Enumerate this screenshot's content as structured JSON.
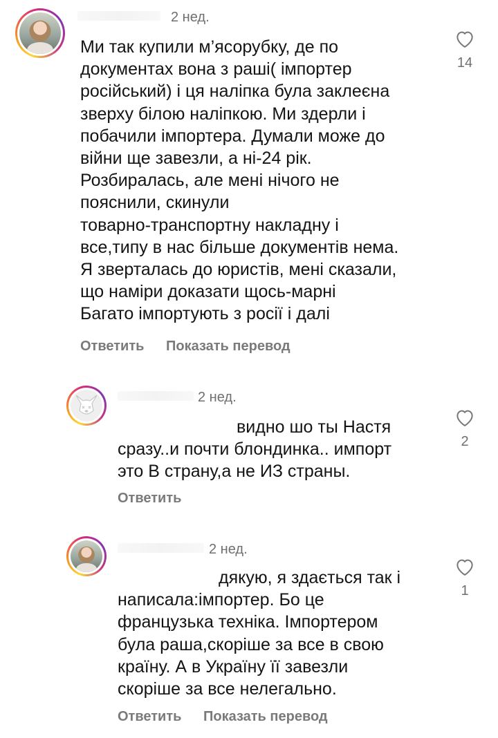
{
  "comments": [
    {
      "time": "2 нед.",
      "lines": [
        "Ми так купили м’ясорубку, де по",
        "документах вона з раші( імпортер",
        "російський) і ця наліпка була заклеєна",
        "зверху білою наліпкою. Ми здерли і",
        "побачили імпортера. Думали може до",
        "війни ще завезли, а ні-24 рік.",
        "Розбиралась, але мені нічого не",
        "пояснили, скинули",
        "товарно-транспортну накладну і",
        "все,типу в нас більше документів нема.",
        "Я зверталась до юристів, мені сказали,",
        "що наміри доказати щось-марні",
        "Багато імпортують з росії і далі"
      ],
      "reply_label": "Ответить",
      "translate_label": "Показать перевод",
      "likes": "14",
      "avatar_icon": "woman-avatar"
    },
    {
      "time": "2 нед.",
      "lines": [
        "видно шо ты Настя",
        "сразу..и почти блондинка.. импорт",
        "это В страну,а не ИЗ страны."
      ],
      "reply_label": "Ответить",
      "likes": "2",
      "avatar_icon": "dog-avatar"
    },
    {
      "time": "2 нед.",
      "lines": [
        "дякую, я здається так і",
        "написала:імпортер. Бо це",
        "французька техніка. Імпортером",
        "була раша,скоріше за все в свою",
        "країну. А в Україну її завезли",
        "скоріше за все нелегально."
      ],
      "reply_label": "Ответить",
      "translate_label": "Показать перевод",
      "likes": "1",
      "avatar_icon": "woman-avatar"
    }
  ],
  "icons": {
    "like": "heart-outline-icon"
  },
  "colors": {
    "text": "#141414",
    "muted": "#7a7a7a",
    "story_ring": [
      "#fdd835",
      "#f58529",
      "#dd2a7b",
      "#8134af"
    ]
  }
}
